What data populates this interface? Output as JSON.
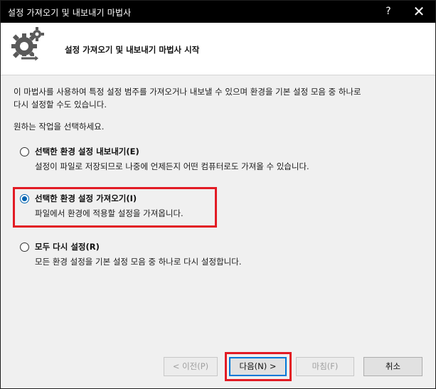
{
  "window": {
    "title": "설정 가져오기 및 내보내기 마법사",
    "help_label": "?",
    "close_label": "✕"
  },
  "header": {
    "title": "설정 가져오기 및 내보내기 마법사 시작",
    "icon": "gear-arrow-icon"
  },
  "intro": {
    "line1": "이 마법사를 사용하여 특정 설정 범주를 가져오거나 내보낼 수 있으며 환경을 기본 설정 모음 중 하나로",
    "line2": "다시 설정할 수도 있습니다.",
    "prompt": "원하는 작업을 선택하세요."
  },
  "options": [
    {
      "label": "선택한 환경 설정 내보내기(E)",
      "description": "설정이 파일로 저장되므로 나중에 언제든지 어떤 컴퓨터로도 가져올 수 있습니다.",
      "selected": false
    },
    {
      "label": "선택한 환경 설정 가져오기(I)",
      "description": "파일에서 환경에 적용할 설정을 가져옵니다.",
      "selected": true
    },
    {
      "label": "모두 다시 설정(R)",
      "description": "모든 환경 설정을 기본 설정 모음 중 하나로 다시 설정합니다.",
      "selected": false
    }
  ],
  "buttons": {
    "previous": "< 이전(P)",
    "next": "다음(N) >",
    "finish": "마침(F)",
    "cancel": "취소"
  },
  "colors": {
    "titlebar": "#000000",
    "highlight": "#e21b24",
    "accent": "#0078d7",
    "logo": "#5a5a5a"
  }
}
